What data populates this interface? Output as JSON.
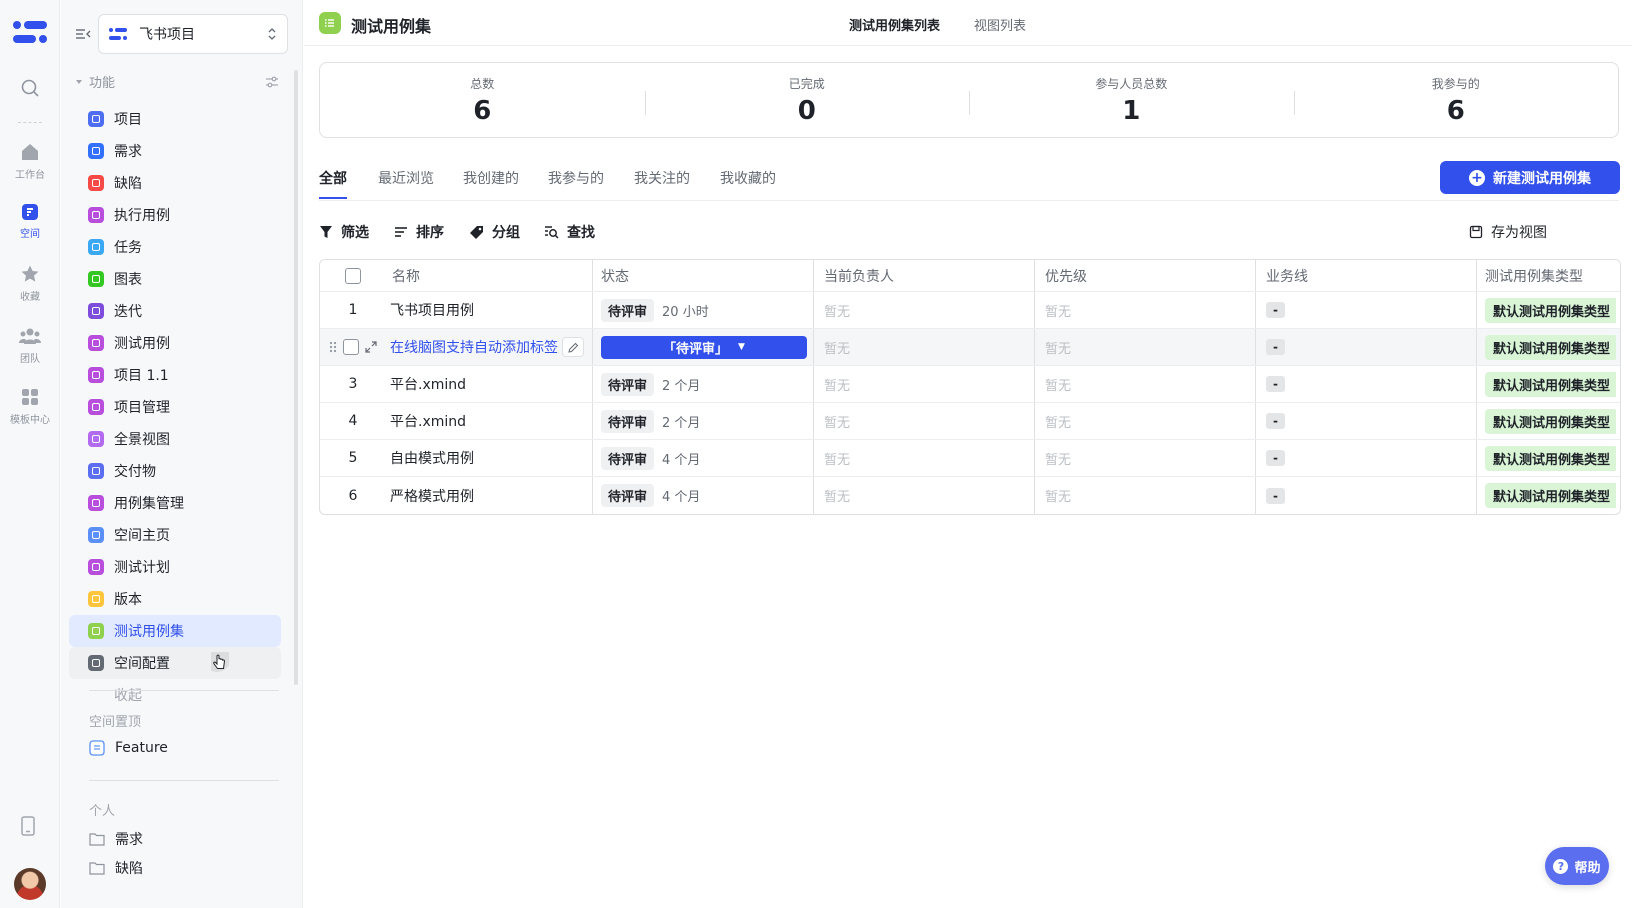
{
  "rail": {
    "items": [
      {
        "label": "",
        "icon": "search-icon"
      },
      {
        "label": "工作台",
        "icon": "home-icon"
      },
      {
        "label": "空间",
        "icon": "space-icon"
      },
      {
        "label": "收藏",
        "icon": "star-icon"
      },
      {
        "label": "团队",
        "icon": "team-icon"
      },
      {
        "label": "模板中心",
        "icon": "template-icon"
      }
    ],
    "active": "空间"
  },
  "sidebar": {
    "project_name": "飞书项目",
    "section_title": "功能",
    "items": [
      {
        "label": "项目",
        "color": "#4e6ef2"
      },
      {
        "label": "需求",
        "color": "#3370ff"
      },
      {
        "label": "缺陷",
        "color": "#f54a45"
      },
      {
        "label": "执行用例",
        "color": "#b84fdc"
      },
      {
        "label": "任务",
        "color": "#3aa8f5"
      },
      {
        "label": "图表",
        "color": "#34c724"
      },
      {
        "label": "迭代",
        "color": "#7d4cdb"
      },
      {
        "label": "测试用例",
        "color": "#b84fdc"
      },
      {
        "label": "项目 1.1",
        "color": "#b84fdc"
      },
      {
        "label": "项目管理",
        "color": "#b84fdc"
      },
      {
        "label": "全景视图",
        "color": "#b26af0"
      },
      {
        "label": "交付物",
        "color": "#5b6ef0"
      },
      {
        "label": "用例集管理",
        "color": "#b84fdc"
      },
      {
        "label": "空间主页",
        "color": "#5b8ff9"
      },
      {
        "label": "测试计划",
        "color": "#b84fdc"
      },
      {
        "label": "版本",
        "color": "#ffc53d"
      },
      {
        "label": "测试用例集",
        "color": "#8fd14f"
      },
      {
        "label": "空间配置",
        "color": "#646a73"
      }
    ],
    "collapse_label": "收起",
    "pinned_title": "空间置顶",
    "pinned_item": "Feature",
    "personal_title": "个人",
    "personal_items": [
      "需求",
      "缺陷"
    ]
  },
  "header": {
    "title": "测试用例集",
    "views": [
      "测试用例集列表",
      "视图列表"
    ]
  },
  "stats": [
    {
      "label": "总数",
      "value": "6"
    },
    {
      "label": "已完成",
      "value": "0"
    },
    {
      "label": "参与人员总数",
      "value": "1"
    },
    {
      "label": "我参与的",
      "value": "6"
    }
  ],
  "tabs": [
    "全部",
    "最近浏览",
    "我创建的",
    "我参与的",
    "我关注的",
    "我收藏的"
  ],
  "new_button": "新建测试用例集",
  "toolbar": {
    "filter": "筛选",
    "sort": "排序",
    "group": "分组",
    "find": "查找",
    "save_view": "存为视图"
  },
  "table": {
    "columns": [
      "名称",
      "状态",
      "当前负责人",
      "优先级",
      "业务线",
      "测试用例集类型"
    ],
    "rows": [
      {
        "idx": "1",
        "name": "飞书项目用例",
        "status": "待评审",
        "time": "20 小时",
        "owner": "暂无",
        "priority": "暂无",
        "line": "-",
        "type": "默认测试用例集类型"
      },
      {
        "idx": "",
        "name": "在线脑图支持自动添加标签",
        "status": "「待评审」",
        "time": "",
        "owner": "暂无",
        "priority": "暂无",
        "line": "-",
        "type": "默认测试用例集类型"
      },
      {
        "idx": "3",
        "name": "平台.xmind",
        "status": "待评审",
        "time": "2 个月",
        "owner": "暂无",
        "priority": "暂无",
        "line": "-",
        "type": "默认测试用例集类型"
      },
      {
        "idx": "4",
        "name": "平台.xmind",
        "status": "待评审",
        "time": "2 个月",
        "owner": "暂无",
        "priority": "暂无",
        "line": "-",
        "type": "默认测试用例集类型"
      },
      {
        "idx": "5",
        "name": "自由模式用例",
        "status": "待评审",
        "time": "4 个月",
        "owner": "暂无",
        "priority": "暂无",
        "line": "-",
        "type": "默认测试用例集类型"
      },
      {
        "idx": "6",
        "name": "严格模式用例",
        "status": "待评审",
        "time": "4 个月",
        "owner": "暂无",
        "priority": "暂无",
        "line": "-",
        "type": "默认测试用例集类型"
      }
    ]
  },
  "help_label": "帮助"
}
